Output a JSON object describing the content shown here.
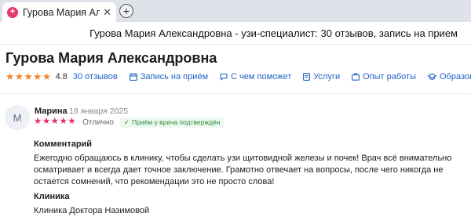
{
  "browser": {
    "tab_title": "Гурова Мария Алекса",
    "favicon": "+",
    "tab_close": "✕",
    "new_tab": "+"
  },
  "window_title": "Гурова Мария Александровна - узи-специалист: 30 отзывов, запись на прием",
  "doctor": {
    "name": "Гурова Мария Александровна",
    "rating": "4.8",
    "stars": 5,
    "star_color": "#f0832e",
    "reviews_link": "30 отзывов",
    "nav": {
      "appointment": "Запись на приём",
      "help": "С чем поможет",
      "services": "Услуги",
      "experience": "Опыт работы",
      "education": "Образование"
    },
    "nav_icons": [
      "calendar-icon",
      "chat-icon",
      "document-icon",
      "briefcase-icon",
      "graduation-cap-icon"
    ],
    "link_color": "#1f63c7"
  },
  "review": {
    "avatar_letter": "М",
    "author": "Марина",
    "date": "18 января 2025",
    "stars": 5,
    "star_color": "#ea2a78",
    "grade": "Отлично",
    "verified": "Приём у врача подтверждён",
    "comment_label": "Комментарий",
    "comment": "Ежегодно обращаюсь в клинику, чтобы сделать узи щитовидной железы и почек! Врач всё внимательно осматривает и всегда дает точное заключение. Грамотно отвечает на вопросы, после чего никогда не остается сомнений, что рекомендации это не просто слова!",
    "clinic_label": "Клиника",
    "clinic": "Клиника Доктора Назимовой"
  }
}
